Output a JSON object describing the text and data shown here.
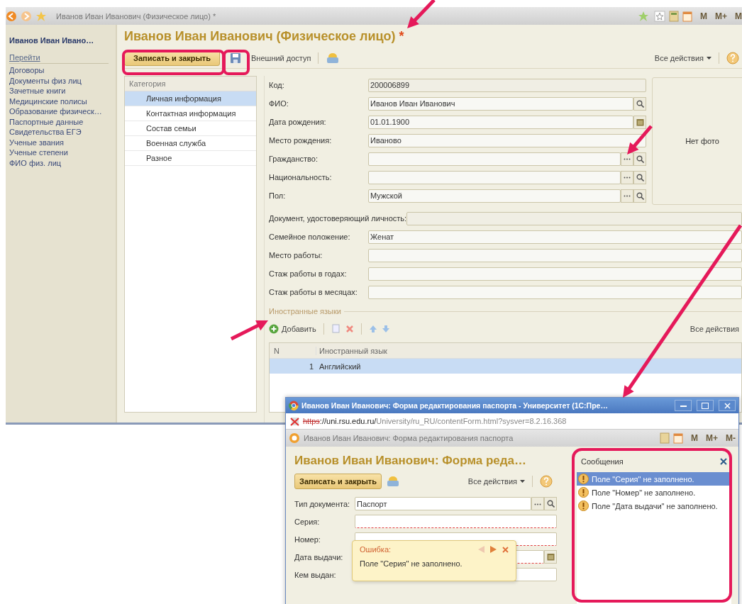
{
  "window": {
    "title": "Иванов Иван Иванович (Физическое лицо) *",
    "memory_keys": [
      "M",
      "M+",
      "M"
    ]
  },
  "sidebar": {
    "title": "Иванов Иван Ивано…",
    "section": "Перейти",
    "items": [
      "Договоры",
      "Документы физ лиц",
      "Зачетные книги",
      "Медицинские полисы",
      "Образование физическ…",
      "Паспортные данные",
      "Свидетельства ЕГЭ",
      "Ученые звания",
      "Ученые степени",
      "ФИО физ. лиц"
    ]
  },
  "form": {
    "title": "Иванов Иван Иванович (Физическое лицо)",
    "modified_mark": "*",
    "toolbar": {
      "save_close": "Записать и закрыть",
      "external_access": "Внешний доступ",
      "all_actions": "Все действия"
    },
    "categories": {
      "header": "Категория",
      "items": [
        {
          "label": "Личная информация",
          "selected": true
        },
        {
          "label": "Контактная информация",
          "selected": false
        },
        {
          "label": "Состав семьи",
          "selected": false
        },
        {
          "label": "Военная служба",
          "selected": false
        },
        {
          "label": "Разное",
          "selected": false
        }
      ]
    },
    "fields": [
      {
        "label": "Код:",
        "value": "200006899",
        "kind": "readonly"
      },
      {
        "label": "ФИО:",
        "value": "Иванов Иван Иванович",
        "kind": "lookup"
      },
      {
        "label": "Дата рождения:",
        "value": "01.01.1900",
        "kind": "date"
      },
      {
        "label": "Место рождения:",
        "value": "Иваново",
        "kind": "text"
      },
      {
        "label": "Гражданство:",
        "kind": "choice"
      },
      {
        "label": "Национальность:",
        "kind": "choice"
      },
      {
        "label": "Пол:",
        "value": "Мужской",
        "kind": "choice"
      }
    ],
    "photo": "Нет фото",
    "wide_fields": [
      {
        "label": "Документ, удостоверяющий личность:",
        "kind": "readonly"
      },
      {
        "label": "Семейное положение:",
        "value": "Женат",
        "kind": "text"
      },
      {
        "label": "Место работы:",
        "kind": "text"
      },
      {
        "label": "Стаж работы в годах:",
        "kind": "text"
      },
      {
        "label": "Стаж работы в месяцах:",
        "kind": "text"
      }
    ],
    "languages": {
      "title": "Иностранные языки",
      "add": "Добавить",
      "all_actions": "Все действия",
      "columns": [
        "N",
        "Иностранный язык"
      ],
      "rows": [
        {
          "n": "1",
          "language": "Английский",
          "selected": true
        }
      ]
    }
  },
  "popup": {
    "title": "Иванов Иван Иванович: Форма редактирования паспорта - Университет (1С:Пре…",
    "url_scheme": "https",
    "url_host": "://uni.rsu.edu.ru/",
    "url_path": "University/ru_RU/contentForm.html?sysver=8.2.16.368",
    "app_title": "Иванов Иван Иванович: Форма редактирования паспорта",
    "memory_keys": [
      "M",
      "M+",
      "M-"
    ],
    "heading": "Иванов Иван Иванович: Форма реда…",
    "save_close": "Записать и закрыть",
    "all_actions": "Все действия",
    "fields": [
      {
        "label": "Тип документа:",
        "value": "Паспорт",
        "kind": "choice",
        "error": false
      },
      {
        "label": "Серия:",
        "kind": "text",
        "error": true
      },
      {
        "label": "Номер:",
        "kind": "text",
        "error": true
      },
      {
        "label": "Дата выдачи:",
        "kind": "date",
        "error": true
      },
      {
        "label": "Кем выдан:",
        "kind": "text",
        "error": false
      }
    ],
    "error_tip": {
      "title": "Ошибка:",
      "text": "Поле \"Серия\" не заполнено."
    },
    "messages": {
      "title": "Сообщения",
      "items": [
        {
          "text": "Поле \"Серия\" не заполнено.",
          "selected": true
        },
        {
          "text": "Поле \"Номер\" не заполнено.",
          "selected": false
        },
        {
          "text": "Поле \"Дата выдачи\" не заполнено.",
          "selected": false
        }
      ]
    }
  }
}
